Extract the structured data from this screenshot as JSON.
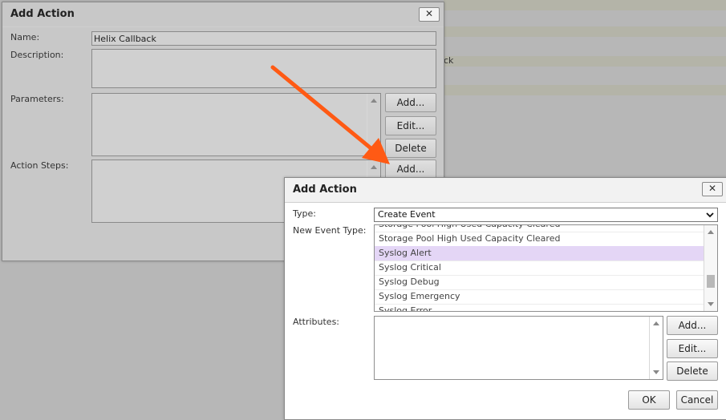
{
  "background": {
    "partial_text": "ck"
  },
  "back_dialog": {
    "title": "Add Action",
    "close": "✕",
    "name_label": "Name:",
    "name_value": "Helix Callback",
    "description_label": "Description:",
    "parameters_label": "Parameters:",
    "action_steps_label": "Action Steps:",
    "buttons": {
      "add": "Add...",
      "edit": "Edit...",
      "delete": "Delete",
      "add2": "Add..."
    }
  },
  "front_dialog": {
    "title": "Add Action",
    "close": "✕",
    "type_label": "Type:",
    "type_value": "Create Event",
    "type_options": [
      "Create Event"
    ],
    "event_type_label": "New Event Type:",
    "event_types": [
      "Storage Pool High Used Capacity Cleared",
      "Storage Pool High Used Capacity Cleared",
      "Syslog Alert",
      "Syslog Critical",
      "Syslog Debug",
      "Syslog Emergency",
      "Syslog Error"
    ],
    "selected_event_type": "Syslog Alert",
    "attributes_label": "Attributes:",
    "buttons": {
      "add": "Add...",
      "edit": "Edit...",
      "delete": "Delete",
      "ok": "OK",
      "cancel": "Cancel"
    }
  },
  "annotation": {
    "arrow_color": "#ff5a14",
    "highlight_color": "#e4d6f6"
  }
}
